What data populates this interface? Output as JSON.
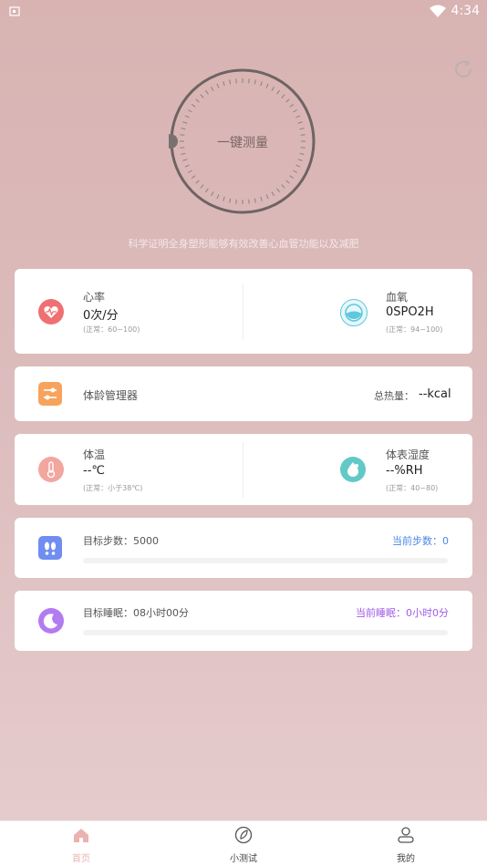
{
  "status_bar": {
    "time": "4:34"
  },
  "dial": {
    "label": "一键测量"
  },
  "tagline": "科学证明全身塑形能够有效改善心血管功能以及减肥",
  "vitals": {
    "heart_rate": {
      "label": "心率",
      "value": "0次/分",
      "normal": "(正常：60~100)"
    },
    "blood_oxygen": {
      "label": "血氧",
      "value": "0SPO2H",
      "normal": "(正常：94~100)"
    }
  },
  "body_age": {
    "label": "体龄管理器",
    "calorie_label": "总热量：",
    "calorie_value": "--kcal"
  },
  "temperature": {
    "body_temp": {
      "label": "体温",
      "value": "--℃",
      "normal": "(正常：小于38℃)"
    },
    "surface_humidity": {
      "label": "体表湿度",
      "value": "--%RH",
      "normal": "(正常：40~80)"
    }
  },
  "steps": {
    "target": "目标步数：5000",
    "current": "当前步数：0",
    "progress": 0
  },
  "sleep": {
    "target": "目标睡眠：08小时00分",
    "current": "当前睡眠：0小时0分",
    "progress": 0
  },
  "colors": {
    "heart": "#ef6f72",
    "oxygen": "#5ec8dc",
    "body_age": "#f7a35c",
    "temperature": "#f2a6a0",
    "humidity": "#62c9c7",
    "steps": "#6f8df2",
    "sleep": "#b27cf0",
    "steps_text": "#4d87e8",
    "sleep_text": "#9f5ce6",
    "tab_active": "#eab3b0"
  },
  "tabs": [
    {
      "label": "首页",
      "icon": "home-icon",
      "active": true
    },
    {
      "label": "小测试",
      "icon": "leaf-icon",
      "active": false
    },
    {
      "label": "我的",
      "icon": "user-icon",
      "active": false
    }
  ]
}
